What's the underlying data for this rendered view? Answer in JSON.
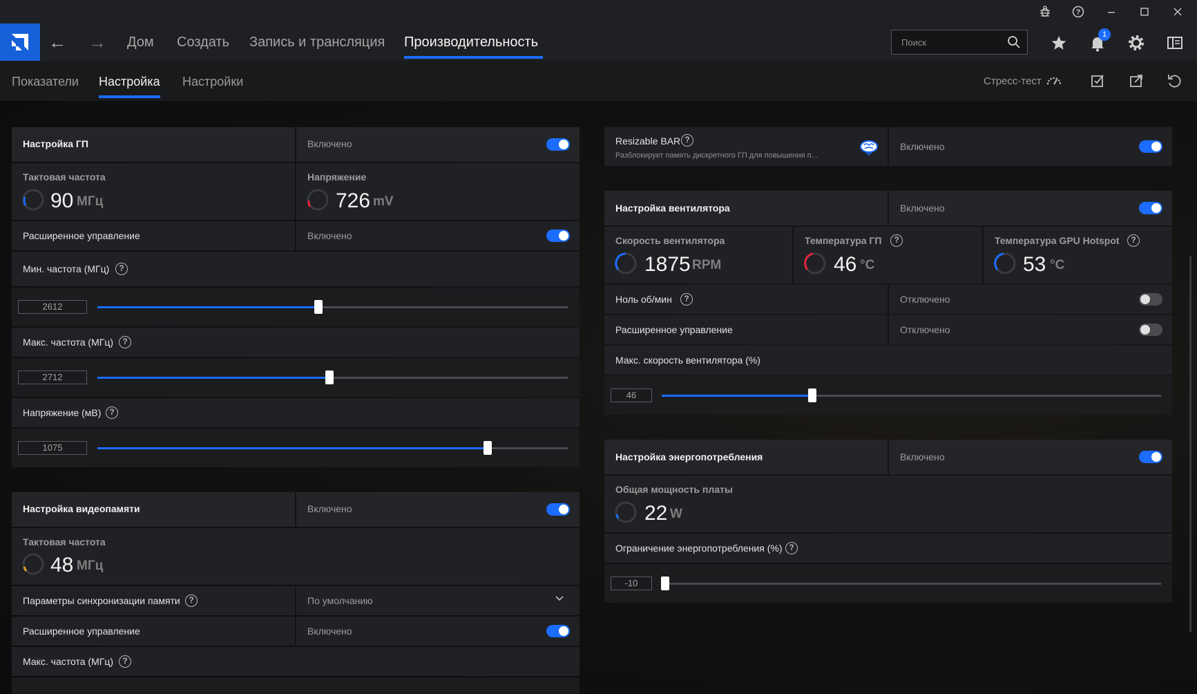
{
  "window": {
    "controls": [
      "bug-icon",
      "help-icon",
      "minimize-icon",
      "maximize-icon",
      "close-icon"
    ]
  },
  "nav": {
    "tabs": [
      {
        "label": "Дом"
      },
      {
        "label": "Создать"
      },
      {
        "label": "Запись и трансляция"
      },
      {
        "label": "Производительность"
      }
    ],
    "active_tab": "Производительность",
    "search_placeholder": "Поиск",
    "notifications_count": "1"
  },
  "subnav": {
    "tabs": [
      {
        "label": "Показатели"
      },
      {
        "label": "Настройка"
      },
      {
        "label": "Настройки"
      }
    ],
    "active_tab": "Настройка",
    "stress_test": "Стресс-тест"
  },
  "gpu": {
    "title": "Настройка ГП",
    "status": "Включено",
    "clock_label": "Тактовая частота",
    "clock_value": "90",
    "clock_unit": "МГц",
    "voltage_label": "Напряжение",
    "voltage_value": "726",
    "voltage_unit": "mV",
    "advanced_label": "Расширенное управление",
    "advanced_status": "Включено",
    "min_freq_label": "Мин. частота (МГц)",
    "min_freq_value": "2612",
    "min_freq_fraction": 0.47,
    "max_freq_label": "Макс. частота (МГц)",
    "max_freq_value": "2712",
    "max_freq_fraction": 0.493,
    "voltage_mv_label": "Напряжение (мВ)",
    "voltage_mv_value": "1075",
    "voltage_mv_fraction": 0.829
  },
  "vram": {
    "title": "Настройка видеопамяти",
    "status": "Включено",
    "clock_label": "Тактовая частота",
    "clock_value": "48",
    "clock_unit": "МГц",
    "timing_label": "Параметры синхронизации памяти",
    "timing_value": "По умолчанию",
    "advanced_label": "Расширенное управление",
    "advanced_status": "Включено",
    "max_freq_label": "Макс. частота (МГц)"
  },
  "rebar": {
    "title": "Resizable BAR",
    "description": "Разблокирует память дискретного ГП для повышения п...",
    "status": "Включено"
  },
  "fan": {
    "title": "Настройка вентилятора",
    "status": "Включено",
    "speed_label": "Скорость вентилятора",
    "speed_value": "1875",
    "speed_unit": "RPM",
    "gpu_temp_label": "Температура ГП",
    "gpu_temp_value": "46",
    "gpu_temp_unit": "°C",
    "hotspot_label": "Температура GPU Hotspot",
    "hotspot_value": "53",
    "hotspot_unit": "°C",
    "zero_rpm_label": "Ноль об/мин",
    "zero_rpm_status": "Отключено",
    "advanced_label": "Расширенное управление",
    "advanced_status": "Отключено",
    "max_speed_label": "Макс. скорость вентилятора (%)",
    "max_speed_value": "46",
    "max_speed_fraction": 0.302
  },
  "power": {
    "title": "Настройка энергопотребления",
    "status": "Включено",
    "board_power_label": "Общая мощность платы",
    "board_power_value": "22",
    "board_power_unit": "W",
    "limit_label": "Ограничение энергопотребления (%)",
    "limit_value": "-10",
    "limit_fraction": 0.0
  },
  "colors": {
    "accent": "#1b6cff",
    "logo": "#1660d9",
    "temp_warn": "#e0243a"
  }
}
